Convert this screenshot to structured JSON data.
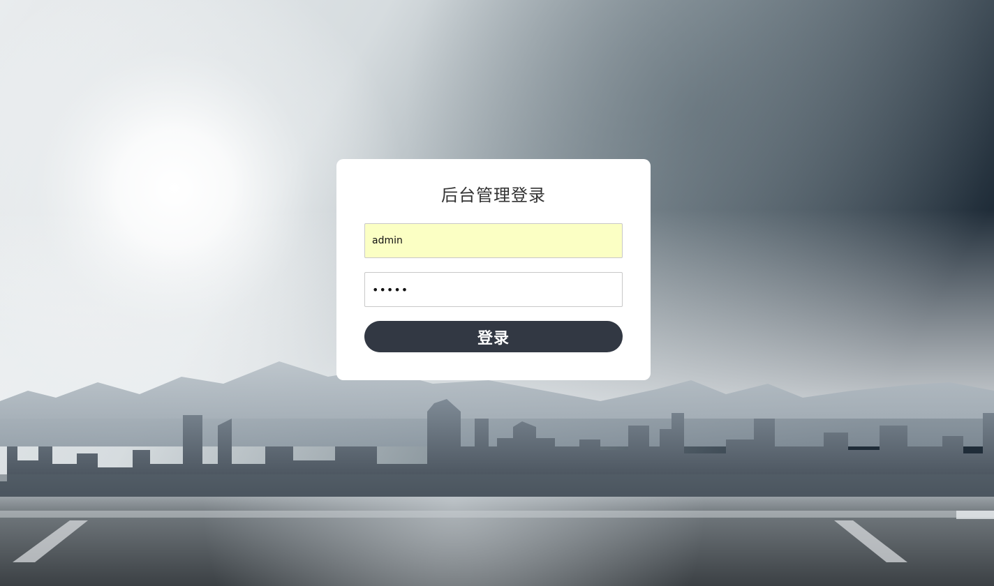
{
  "login": {
    "title": "后台管理登录",
    "username": {
      "value": "admin",
      "placeholder": ""
    },
    "password": {
      "value": "•••••",
      "placeholder": ""
    },
    "submit_label": "登录"
  },
  "colors": {
    "card_background": "#ffffff",
    "button_background": "#323843",
    "button_text": "#ffffff",
    "username_autofill_background": "#fbffc4",
    "title_text": "#333333"
  },
  "background": {
    "description_icon": "city-skyline-background"
  }
}
